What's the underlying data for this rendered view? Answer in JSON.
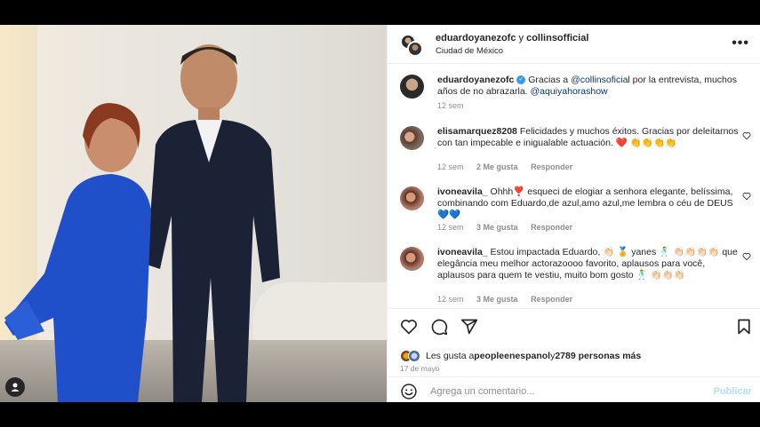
{
  "header": {
    "user1": "eduardoyanezofc",
    "joiner": "y",
    "user2": "collinsofficial",
    "location": "Ciudad de México",
    "more_label": "•••"
  },
  "caption": {
    "user": "eduardoyanezofc",
    "pre": "Gracias a ",
    "mention1": "@collinsoficial",
    "mid": " por la entrevista, muchos años de no abrazarla. ",
    "mention2": "@aquiyahorashow",
    "time": "12 sem"
  },
  "comments": [
    {
      "user": "elisamarquez8208",
      "text": "Felicidades y muchos éxitos. Gracias por deleitarnos con tan impecable e inigualable actuación. ❤️ 👏👏👏👏",
      "time": "12 sem",
      "likes": "2 Me gusta",
      "reply": "Responder"
    },
    {
      "user": "ivoneavila_",
      "text": "Ohhh❣️ esqueci de elogiar a senhora elegante, belíssima, combinando com Eduardo,de azul,amo azul,me lembra o céu de DEUS 💙💙",
      "time": "12 sem",
      "likes": "3 Me gusta",
      "reply": "Responder"
    },
    {
      "user": "ivoneavila_",
      "text": "Estou impactada Eduardo, 👏🏻 🏅 yanes 🕺 👏🏻👏🏻👏🏻👏🏻 que elegância meu melhor actorazoooo favorito, aplausos para você, aplausos para quem te vestiu, muito bom gosto 🕺 👏🏻👏🏻👏🏻",
      "time": "12 sem",
      "likes": "3 Me gusta",
      "reply": "Responder"
    }
  ],
  "likes_line": {
    "pre": "Les gusta a ",
    "user": "peopleenespanol",
    "mid": " y ",
    "count": "2789 personas más"
  },
  "date": "17 de mayo",
  "add_comment": {
    "placeholder": "Agrega un comentario...",
    "publish": "Publicar"
  },
  "colors": {
    "verified": "#3897f0",
    "link": "#00376b",
    "publish_disabled": "#b2dffc",
    "dress": "#1f4fc9",
    "suit": "#1c2236"
  },
  "icons": [
    "more-icon",
    "verified-icon",
    "heart-icon",
    "comment-icon",
    "share-icon",
    "bookmark-icon",
    "emoji-icon",
    "user-tag-icon"
  ]
}
